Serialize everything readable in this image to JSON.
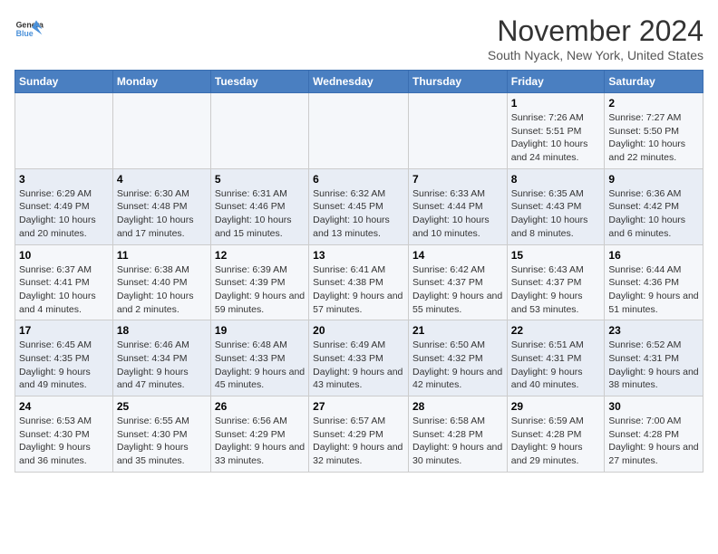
{
  "header": {
    "logo_general": "General",
    "logo_blue": "Blue",
    "month_title": "November 2024",
    "location": "South Nyack, New York, United States"
  },
  "days_of_week": [
    "Sunday",
    "Monday",
    "Tuesday",
    "Wednesday",
    "Thursday",
    "Friday",
    "Saturday"
  ],
  "weeks": [
    {
      "days": [
        {
          "number": "",
          "info": ""
        },
        {
          "number": "",
          "info": ""
        },
        {
          "number": "",
          "info": ""
        },
        {
          "number": "",
          "info": ""
        },
        {
          "number": "",
          "info": ""
        },
        {
          "number": "1",
          "info": "Sunrise: 7:26 AM\nSunset: 5:51 PM\nDaylight: 10 hours and 24 minutes."
        },
        {
          "number": "2",
          "info": "Sunrise: 7:27 AM\nSunset: 5:50 PM\nDaylight: 10 hours and 22 minutes."
        }
      ]
    },
    {
      "days": [
        {
          "number": "3",
          "info": "Sunrise: 6:29 AM\nSunset: 4:49 PM\nDaylight: 10 hours and 20 minutes."
        },
        {
          "number": "4",
          "info": "Sunrise: 6:30 AM\nSunset: 4:48 PM\nDaylight: 10 hours and 17 minutes."
        },
        {
          "number": "5",
          "info": "Sunrise: 6:31 AM\nSunset: 4:46 PM\nDaylight: 10 hours and 15 minutes."
        },
        {
          "number": "6",
          "info": "Sunrise: 6:32 AM\nSunset: 4:45 PM\nDaylight: 10 hours and 13 minutes."
        },
        {
          "number": "7",
          "info": "Sunrise: 6:33 AM\nSunset: 4:44 PM\nDaylight: 10 hours and 10 minutes."
        },
        {
          "number": "8",
          "info": "Sunrise: 6:35 AM\nSunset: 4:43 PM\nDaylight: 10 hours and 8 minutes."
        },
        {
          "number": "9",
          "info": "Sunrise: 6:36 AM\nSunset: 4:42 PM\nDaylight: 10 hours and 6 minutes."
        }
      ]
    },
    {
      "days": [
        {
          "number": "10",
          "info": "Sunrise: 6:37 AM\nSunset: 4:41 PM\nDaylight: 10 hours and 4 minutes."
        },
        {
          "number": "11",
          "info": "Sunrise: 6:38 AM\nSunset: 4:40 PM\nDaylight: 10 hours and 2 minutes."
        },
        {
          "number": "12",
          "info": "Sunrise: 6:39 AM\nSunset: 4:39 PM\nDaylight: 9 hours and 59 minutes."
        },
        {
          "number": "13",
          "info": "Sunrise: 6:41 AM\nSunset: 4:38 PM\nDaylight: 9 hours and 57 minutes."
        },
        {
          "number": "14",
          "info": "Sunrise: 6:42 AM\nSunset: 4:37 PM\nDaylight: 9 hours and 55 minutes."
        },
        {
          "number": "15",
          "info": "Sunrise: 6:43 AM\nSunset: 4:37 PM\nDaylight: 9 hours and 53 minutes."
        },
        {
          "number": "16",
          "info": "Sunrise: 6:44 AM\nSunset: 4:36 PM\nDaylight: 9 hours and 51 minutes."
        }
      ]
    },
    {
      "days": [
        {
          "number": "17",
          "info": "Sunrise: 6:45 AM\nSunset: 4:35 PM\nDaylight: 9 hours and 49 minutes."
        },
        {
          "number": "18",
          "info": "Sunrise: 6:46 AM\nSunset: 4:34 PM\nDaylight: 9 hours and 47 minutes."
        },
        {
          "number": "19",
          "info": "Sunrise: 6:48 AM\nSunset: 4:33 PM\nDaylight: 9 hours and 45 minutes."
        },
        {
          "number": "20",
          "info": "Sunrise: 6:49 AM\nSunset: 4:33 PM\nDaylight: 9 hours and 43 minutes."
        },
        {
          "number": "21",
          "info": "Sunrise: 6:50 AM\nSunset: 4:32 PM\nDaylight: 9 hours and 42 minutes."
        },
        {
          "number": "22",
          "info": "Sunrise: 6:51 AM\nSunset: 4:31 PM\nDaylight: 9 hours and 40 minutes."
        },
        {
          "number": "23",
          "info": "Sunrise: 6:52 AM\nSunset: 4:31 PM\nDaylight: 9 hours and 38 minutes."
        }
      ]
    },
    {
      "days": [
        {
          "number": "24",
          "info": "Sunrise: 6:53 AM\nSunset: 4:30 PM\nDaylight: 9 hours and 36 minutes."
        },
        {
          "number": "25",
          "info": "Sunrise: 6:55 AM\nSunset: 4:30 PM\nDaylight: 9 hours and 35 minutes."
        },
        {
          "number": "26",
          "info": "Sunrise: 6:56 AM\nSunset: 4:29 PM\nDaylight: 9 hours and 33 minutes."
        },
        {
          "number": "27",
          "info": "Sunrise: 6:57 AM\nSunset: 4:29 PM\nDaylight: 9 hours and 32 minutes."
        },
        {
          "number": "28",
          "info": "Sunrise: 6:58 AM\nSunset: 4:28 PM\nDaylight: 9 hours and 30 minutes."
        },
        {
          "number": "29",
          "info": "Sunrise: 6:59 AM\nSunset: 4:28 PM\nDaylight: 9 hours and 29 minutes."
        },
        {
          "number": "30",
          "info": "Sunrise: 7:00 AM\nSunset: 4:28 PM\nDaylight: 9 hours and 27 minutes."
        }
      ]
    }
  ]
}
